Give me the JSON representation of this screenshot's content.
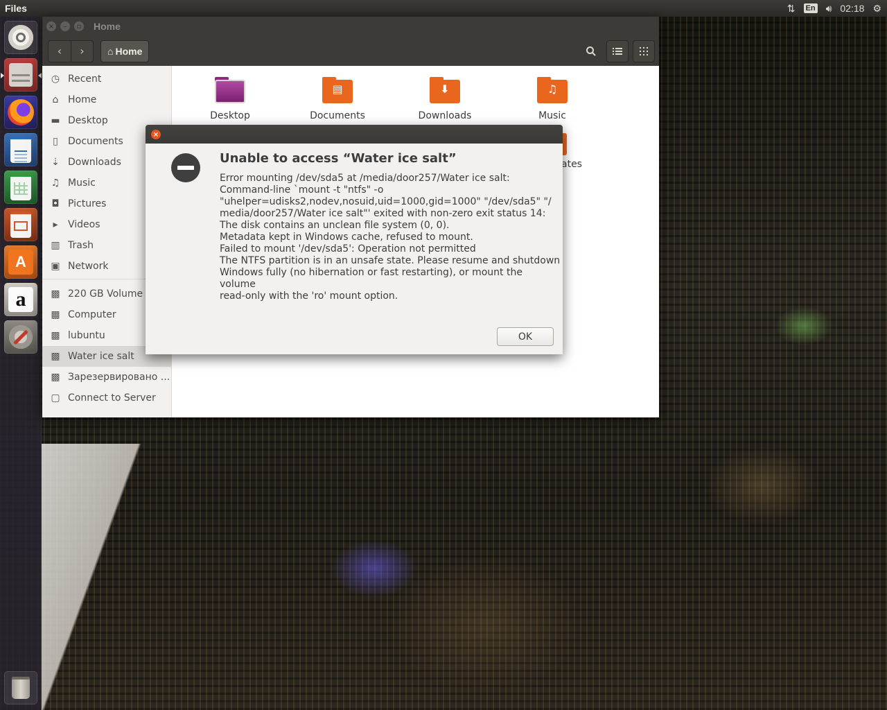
{
  "top_panel": {
    "app_title": "Files",
    "keyboard_layout": "En",
    "clock": "02:18",
    "icons": [
      "network-updown-icon",
      "volume-icon",
      "settings-gear-icon"
    ]
  },
  "launcher": {
    "items": [
      {
        "name": "dash-home",
        "icon": "ubuntu-logo-icon"
      },
      {
        "name": "files",
        "icon": "file-cabinet-icon",
        "active": true
      },
      {
        "name": "firefox",
        "icon": "firefox-icon"
      },
      {
        "name": "writer",
        "icon": "libreoffice-writer-icon"
      },
      {
        "name": "calc",
        "icon": "libreoffice-calc-icon"
      },
      {
        "name": "impress",
        "icon": "libreoffice-impress-icon"
      },
      {
        "name": "software",
        "icon": "software-center-icon"
      },
      {
        "name": "amazon",
        "icon": "amazon-icon"
      },
      {
        "name": "system-settings",
        "icon": "system-settings-icon"
      },
      {
        "name": "trash",
        "icon": "trash-icon"
      }
    ],
    "glyphs": {
      "amazon": "a",
      "software": "A"
    }
  },
  "window": {
    "title": "Home",
    "path_label": "Home",
    "nav": {
      "back": "‹",
      "forward": "›"
    }
  },
  "sidebar": {
    "items": [
      {
        "label": "Recent",
        "icon": "clock-icon",
        "glyph": "◷"
      },
      {
        "label": "Home",
        "icon": "home-icon",
        "glyph": "⌂"
      },
      {
        "label": "Desktop",
        "icon": "folder-icon",
        "glyph": "▬"
      },
      {
        "label": "Documents",
        "icon": "document-icon",
        "glyph": "▯"
      },
      {
        "label": "Downloads",
        "icon": "download-icon",
        "glyph": "⇣"
      },
      {
        "label": "Music",
        "icon": "music-icon",
        "glyph": "♫"
      },
      {
        "label": "Pictures",
        "icon": "camera-icon",
        "glyph": "◘"
      },
      {
        "label": "Videos",
        "icon": "video-icon",
        "glyph": "▸"
      },
      {
        "label": "Trash",
        "icon": "trash-icon",
        "glyph": "▥"
      },
      {
        "label": "Network",
        "icon": "network-icon",
        "glyph": "▣"
      },
      {
        "label": "220 GB Volume",
        "icon": "drive-icon",
        "glyph": "▩"
      },
      {
        "label": "Computer",
        "icon": "drive-icon",
        "glyph": "▩"
      },
      {
        "label": "lubuntu",
        "icon": "drive-icon",
        "glyph": "▩"
      },
      {
        "label": "Water ice salt",
        "icon": "drive-icon",
        "glyph": "▩",
        "active": true
      },
      {
        "label": "Зарезервировано ...",
        "icon": "drive-icon",
        "glyph": "▩"
      },
      {
        "label": "Connect to Server",
        "icon": "server-icon",
        "glyph": "▢"
      }
    ]
  },
  "content": {
    "folders": [
      {
        "label": "Desktop",
        "icon": "desktop-folder-icon",
        "color": "#8b2a80",
        "glyph": ""
      },
      {
        "label": "Documents",
        "icon": "documents-folder-icon",
        "color": "#e9661f",
        "glyph": "▤"
      },
      {
        "label": "Downloads",
        "icon": "downloads-folder-icon",
        "color": "#e9661f",
        "glyph": "⬇"
      },
      {
        "label": "Music",
        "icon": "music-folder-icon",
        "color": "#e9661f",
        "glyph": "♫"
      }
    ],
    "partial_label": "ates"
  },
  "dialog": {
    "heading": "Unable to access “Water ice salt”",
    "lines": [
      "Error mounting /dev/sda5 at /media/door257/Water ice salt:",
      "Command-line `mount -t \"ntfs\" -o",
      "\"uhelper=udisks2,nodev,nosuid,uid=1000,gid=1000\" \"/dev/sda5\" \"/",
      "media/door257/Water ice salt\"' exited with non-zero exit status 14:",
      "The disk contains an unclean file system (0, 0).",
      "Metadata kept in Windows cache, refused to mount.",
      "Failed to mount '/dev/sda5': Operation not permitted",
      "The NTFS partition is in an unsafe state. Please resume and shutdown",
      "Windows fully (no hibernation or fast restarting), or mount the",
      "volume",
      "read-only with the 'ro' mount option."
    ],
    "ok_label": "OK",
    "close_glyph": "×"
  },
  "colors": {
    "accent": "#e95420",
    "panel": "#3c3b37",
    "launcher": "#2d2733"
  }
}
